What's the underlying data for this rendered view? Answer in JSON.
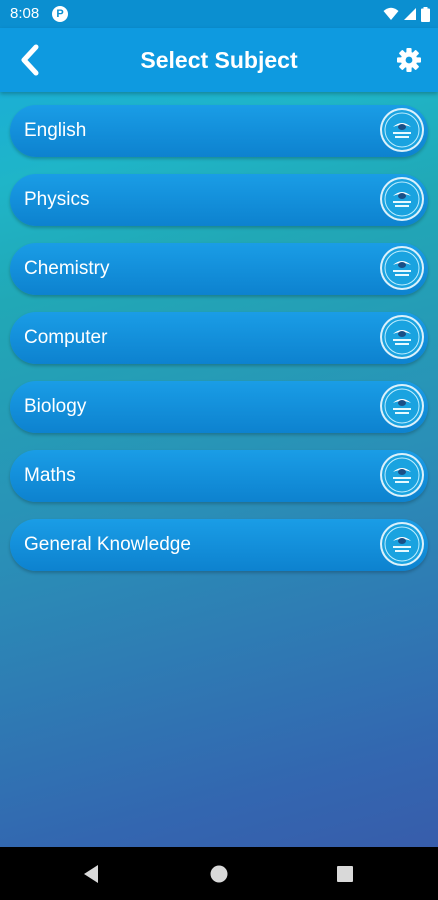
{
  "status_bar": {
    "time": "8:08",
    "app_icon_letter": "P",
    "icons": [
      "wifi-icon",
      "signal-icon",
      "battery-icon"
    ]
  },
  "app_bar": {
    "title": "Select Subject",
    "back_icon": "chevron-left-icon",
    "settings_icon": "gear-icon"
  },
  "subjects": [
    {
      "label": "English"
    },
    {
      "label": "Physics"
    },
    {
      "label": "Chemistry"
    },
    {
      "label": "Computer"
    },
    {
      "label": "Biology"
    },
    {
      "label": "Maths"
    },
    {
      "label": "General Knowledge"
    }
  ],
  "nav_bar": {
    "icons": [
      "back-triangle-icon",
      "home-circle-icon",
      "recents-square-icon"
    ]
  },
  "colors": {
    "app_bar": "#0e9ae0",
    "status_bar": "#0b8fd0",
    "item": "#1392dc",
    "background_top": "#1fb5c8",
    "background_bottom": "#3a58a8"
  }
}
